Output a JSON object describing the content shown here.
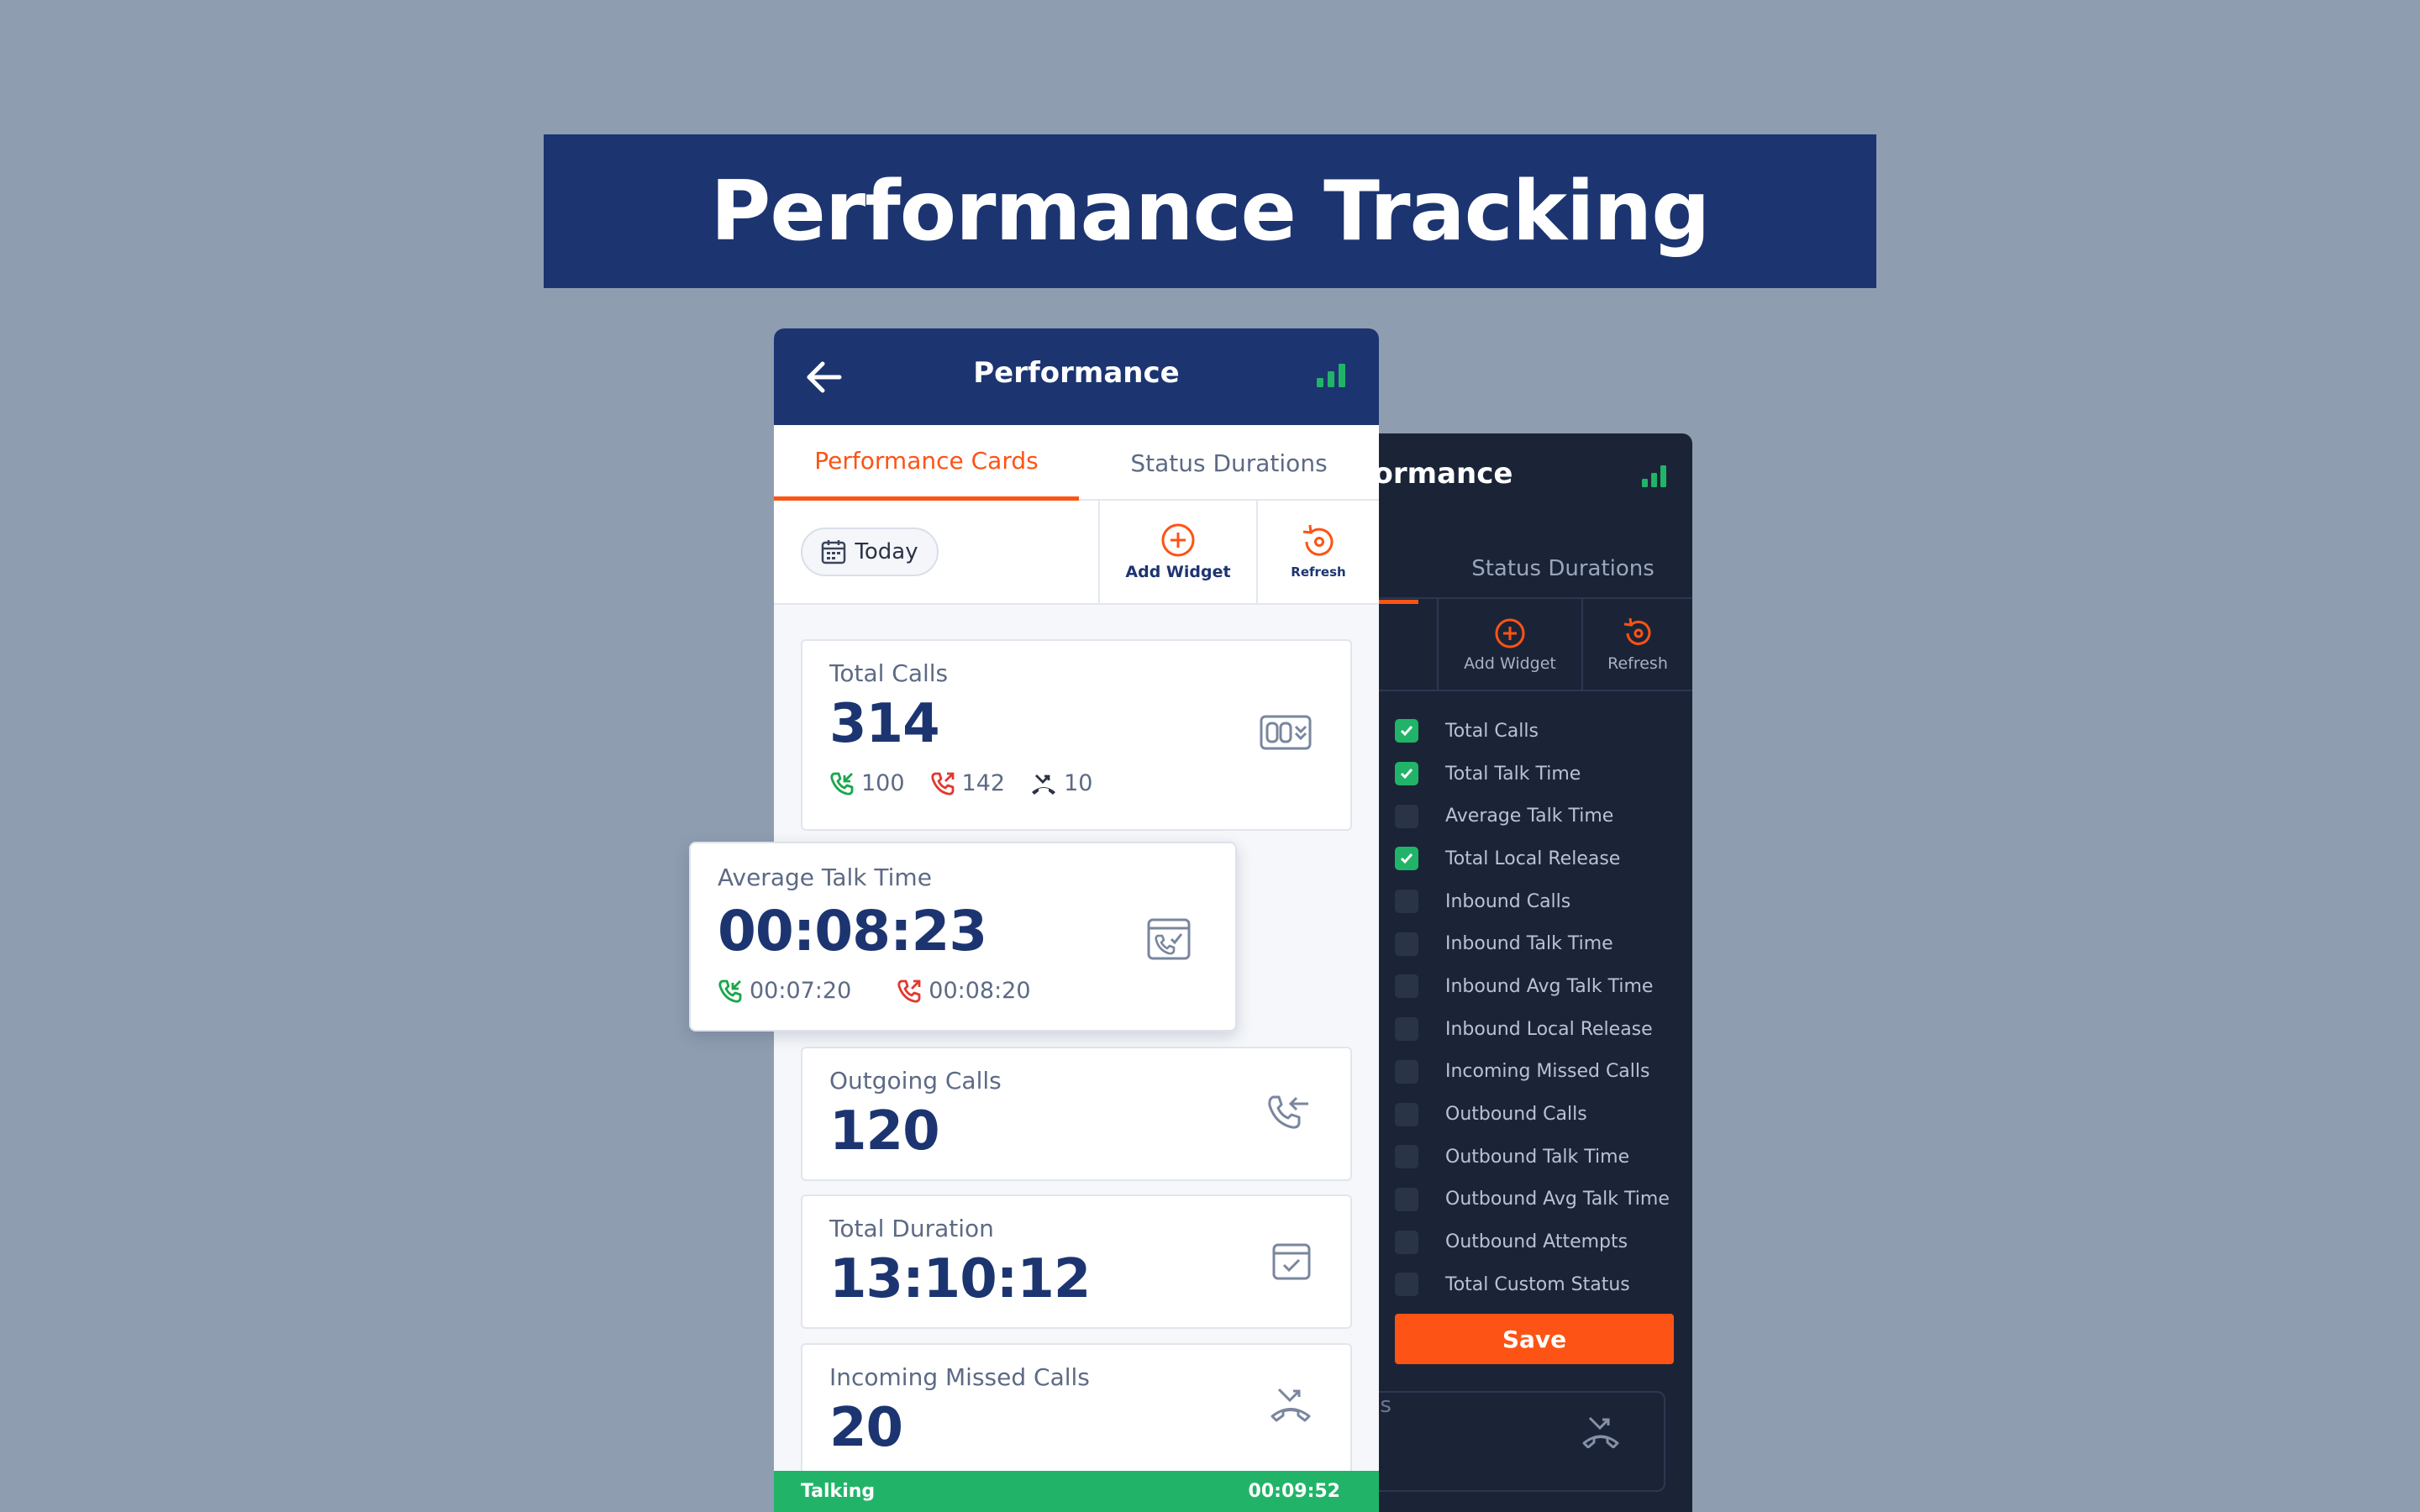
{
  "banner": {
    "title": "Performance Tracking"
  },
  "colors": {
    "brand": "#1c3571",
    "accent": "#fd5315",
    "success": "#21b468",
    "incoming": "#1aa64a",
    "outgoing": "#e03a2f"
  },
  "phone": {
    "title": "Performance",
    "back_icon": "arrow-left-icon",
    "signal_icon": "signal-bars-icon",
    "tabs": [
      {
        "label": "Performance Cards",
        "active": true
      },
      {
        "label": "Status Durations",
        "active": false
      }
    ],
    "toolbar": {
      "date_filter": "Today",
      "add_widget": "Add Widget",
      "refresh": "Refresh"
    },
    "cards": {
      "total_calls": {
        "label": "Total Calls",
        "value": "314",
        "incoming": "100",
        "outgoing": "142",
        "missed": "10",
        "icon": "counter-icon"
      },
      "outgoing_calls": {
        "label": "Outgoing Calls",
        "value": "120",
        "icon": "phone-outgoing-icon"
      },
      "total_duration": {
        "label": "Total Duration",
        "value": "13:10:12",
        "icon": "calendar-check-icon"
      },
      "incoming_missed": {
        "label": "Incoming Missed Calls",
        "value": "20",
        "icon": "missed-call-icon"
      }
    },
    "status_bar": {
      "status": "Talking",
      "timer": "00:09:52"
    }
  },
  "float_card": {
    "label": "Average Talk Time",
    "value": "00:08:23",
    "incoming": "00:07:20",
    "outgoing": "00:08:20",
    "icon": "calendar-call-icon"
  },
  "settings_panel": {
    "title_fragment": "rformance",
    "tab_status": "Status Durations",
    "add_widget": "Add Widget",
    "refresh": "Refresh",
    "items": [
      {
        "label": "Total Calls",
        "checked": true
      },
      {
        "label": "Total Talk Time",
        "checked": true
      },
      {
        "label": "Average Talk Time",
        "checked": false
      },
      {
        "label": "Total Local Release",
        "checked": true
      },
      {
        "label": "Inbound Calls",
        "checked": false
      },
      {
        "label": "Inbound Talk Time",
        "checked": false
      },
      {
        "label": "Inbound Avg Talk Time",
        "checked": false
      },
      {
        "label": "Inbound Local Release",
        "checked": false
      },
      {
        "label": "Incoming Missed Calls",
        "checked": false
      },
      {
        "label": "Outbound Calls",
        "checked": false
      },
      {
        "label": "Outbound Talk Time",
        "checked": false
      },
      {
        "label": "Outbound Avg Talk Time",
        "checked": false
      },
      {
        "label": "Outbound Attempts",
        "checked": false
      },
      {
        "label": "Total Custom Status",
        "checked": false
      }
    ],
    "save_label": "Save",
    "behind_card_fragment": "alls"
  }
}
